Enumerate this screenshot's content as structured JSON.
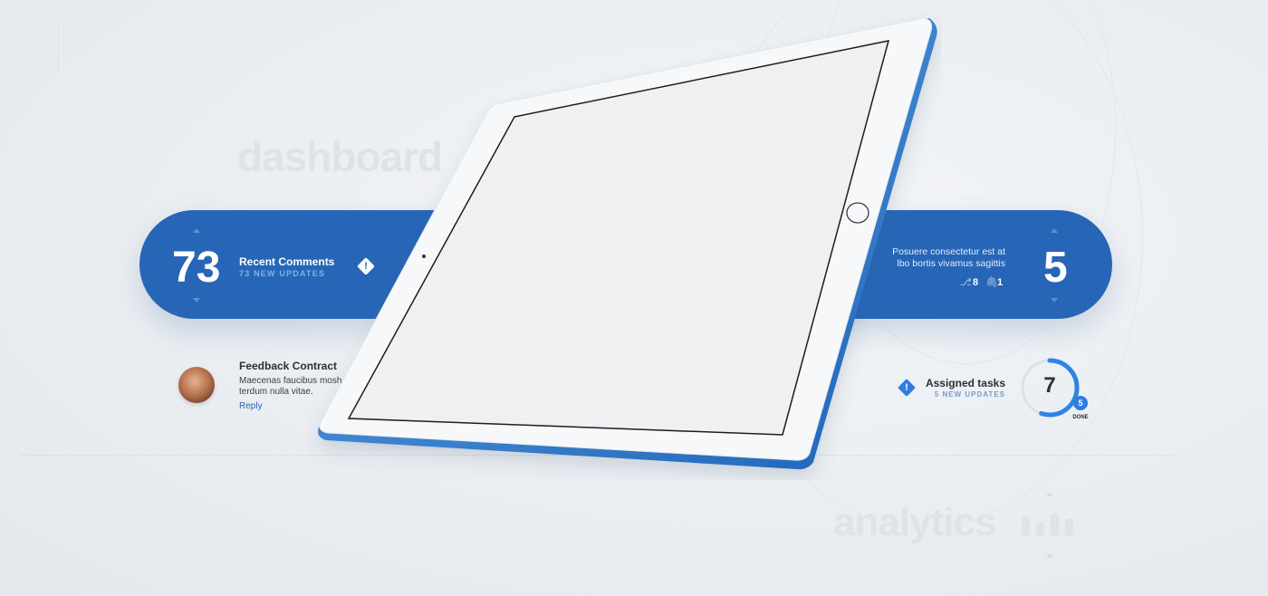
{
  "background": {
    "word_dashboard": "dashboard",
    "word_analytics": "analytics"
  },
  "recent_comments": {
    "count": "73",
    "title": "Recent Comments",
    "subtitle": "73 NEW UPDATES",
    "icon": "alert-diamond-icon"
  },
  "right_card": {
    "text_line1": "Posuere consectetur est at",
    "text_line2": "lbo bortis vivamus sagittis",
    "branches_count": "8",
    "attachments_count": "1",
    "number": "5"
  },
  "feedback": {
    "title": "Feedback Contract",
    "text_line1": "Maecenas faucibus mosh",
    "text_line2": "terdum nulla vitae.",
    "reply_label": "Reply"
  },
  "assigned_tasks": {
    "title": "Assigned tasks",
    "subtitle": "5 NEW UPDATES",
    "total": "7",
    "done_count": "5",
    "done_label": "DONE",
    "progress_fraction": 0.55
  },
  "colors": {
    "accent": "#2766b7",
    "light_accent": "#7fb0ea",
    "background": "#eceff2"
  }
}
